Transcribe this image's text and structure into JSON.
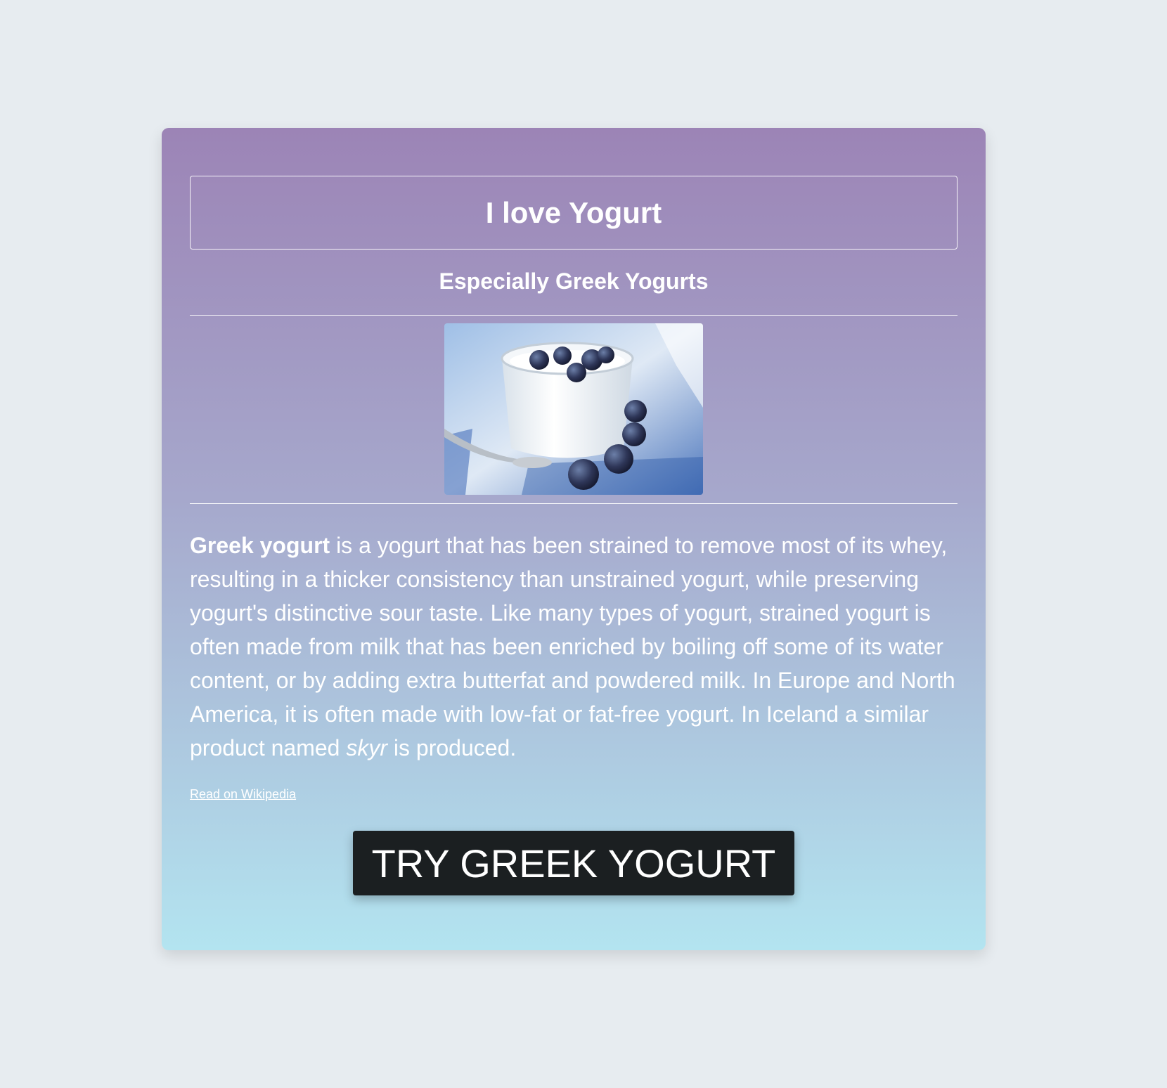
{
  "page": {
    "title": "I love Yogurt",
    "subtitle": "Especially Greek Yogurts"
  },
  "image": {
    "subject": "yogurt-with-blueberries"
  },
  "description": {
    "lead_bold": "Greek yogurt",
    "part1": " is a yogurt that has been strained to remove most of its whey, resulting in a thicker consistency than unstrained yogurt, while preserving yogurt's distinctive sour taste. Like many types of yogurt, strained yogurt is often made from milk that has been enriched by boiling off some of its water content, or by adding extra butterfat and powdered milk. In Europe and North America, it is often made with low-fat or fat-free yogurt. In Iceland a similar product named ",
    "italic_word": "skyr",
    "part2": " is produced."
  },
  "link": {
    "label": "Read on Wikipedia"
  },
  "cta": {
    "label": "TRY GREEK YOGURT"
  },
  "colors": {
    "background": "#e7ecf0",
    "card_gradient_top": "#9c84b6",
    "card_gradient_bottom": "#b3e4f0",
    "button_bg": "#1b1f21",
    "text": "#ffffff"
  }
}
